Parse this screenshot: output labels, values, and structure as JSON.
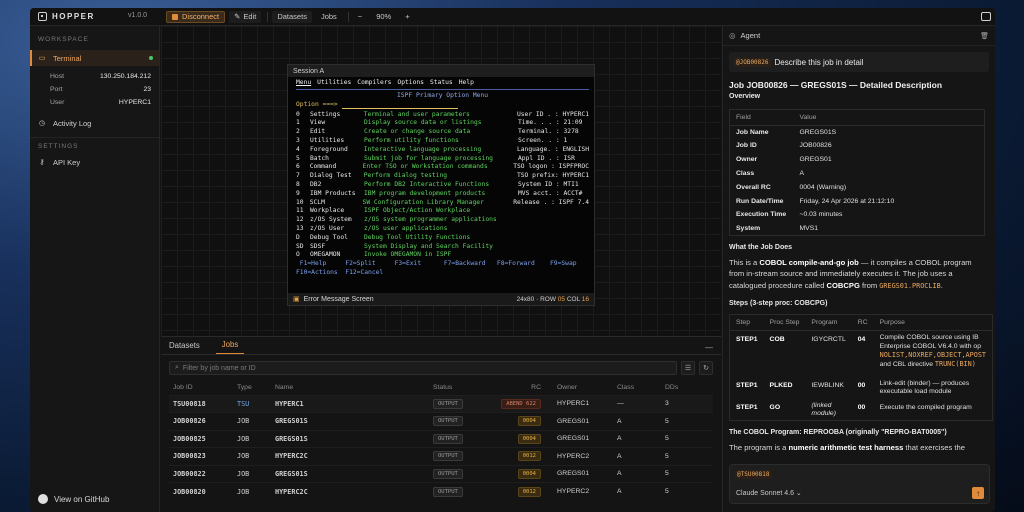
{
  "app": {
    "name": "HOPPER",
    "version": "v1.0.0"
  },
  "toolbar": {
    "disconnect_label": "Disconnect",
    "edit_label": "Edit",
    "datasets_label": "Datasets",
    "jobs_label": "Jobs",
    "zoom_out": "−",
    "zoom": "90%",
    "zoom_in": "+"
  },
  "sidebar": {
    "workspace_header": "WORKSPACE",
    "terminal_label": "Terminal",
    "details": [
      {
        "k": "Host",
        "v": "130.250.184.212"
      },
      {
        "k": "Port",
        "v": "23"
      },
      {
        "k": "User",
        "v": "HYPERC1"
      }
    ],
    "activity_label": "Activity Log",
    "settings_header": "SETTINGS",
    "api_key_label": "API Key",
    "github_label": "View on GitHub"
  },
  "session": {
    "title": "Session A",
    "menu": [
      "Menu",
      "Utilities",
      "Compilers",
      "Options",
      "Status",
      "Help"
    ],
    "panel_title": "ISPF Primary Option Menu",
    "prompt": "Option ===>",
    "options": [
      {
        "num": "0",
        "name": "Settings",
        "desc": "Terminal and user parameters",
        "info": "User ID . : HYPERC1"
      },
      {
        "num": "1",
        "name": "View",
        "desc": "Display source data or listings",
        "info": "Time. . . : 21:09"
      },
      {
        "num": "2",
        "name": "Edit",
        "desc": "Create or change source data",
        "info": "Terminal. : 3278"
      },
      {
        "num": "3",
        "name": "Utilities",
        "desc": "Perform utility functions",
        "info": "Screen. . : 1"
      },
      {
        "num": "4",
        "name": "Foreground",
        "desc": "Interactive language processing",
        "info": "Language. : ENGLISH"
      },
      {
        "num": "5",
        "name": "Batch",
        "desc": "Submit job for language processing",
        "info": "Appl ID . : ISR"
      },
      {
        "num": "6",
        "name": "Command",
        "desc": "Enter TSO or Workstation commands",
        "info": "TSO logon : ISPFPROC"
      },
      {
        "num": "7",
        "name": "Dialog Test",
        "desc": "Perform dialog testing",
        "info": "TSO prefix: HYPERC1"
      },
      {
        "num": "8",
        "name": "DB2",
        "desc": "Perform DB2 Interactive Functions",
        "info": "System ID : MTI1"
      },
      {
        "num": "9",
        "name": "IBM Products",
        "desc": "IBM program development products",
        "info": "MVS acct. : ACCT#"
      },
      {
        "num": "10",
        "name": "SCLM",
        "desc": "SW Configuration Library Manager",
        "info": "Release . : ISPF 7.4"
      },
      {
        "num": "11",
        "name": "Workplace",
        "desc": "ISPF Object/Action Workplace",
        "info": ""
      },
      {
        "num": "12",
        "name": "z/OS System",
        "desc": "z/OS system programmer applications",
        "info": ""
      },
      {
        "num": "13",
        "name": "z/OS User",
        "desc": "z/OS user applications",
        "info": ""
      },
      {
        "num": "D",
        "name": "Debug Tool",
        "desc": "Debug Tool Utility Functions",
        "info": ""
      },
      {
        "num": "SD",
        "name": "SDSF",
        "desc": "System Display and Search Facility",
        "info": ""
      },
      {
        "num": "O",
        "name": "OMEGAMON",
        "desc": "Invoke OMEGAMON in ISPF",
        "info": ""
      }
    ],
    "fkeys_1": " F1=Help     F2=Split     F3=Exit      F7=Backward   F8=Forward    F9=Swap",
    "fkeys_2": "F10=Actions  F12=Cancel",
    "status_msg": "Error Message Screen",
    "geom": "24x80",
    "row_label": "ROW",
    "row": "05",
    "col_label": "COL",
    "col": "16"
  },
  "jobs_panel": {
    "tabs": [
      "Datasets",
      "Jobs"
    ],
    "filter_placeholder": "Filter by job name or ID",
    "columns": [
      "Job ID",
      "Type",
      "Name",
      "Status",
      "RC",
      "Owner",
      "Class",
      "DDs"
    ],
    "rows": [
      {
        "id": "TSU00818",
        "type": "TSU",
        "name": "HYPERC1",
        "status": "OUTPUT",
        "rc": "ABEND 622",
        "owner": "HYPERC1",
        "class": "—",
        "dds": "3"
      },
      {
        "id": "JOB00826",
        "type": "JOB",
        "name": "GREGS01S",
        "status": "OUTPUT",
        "rc": "0004",
        "owner": "GREGS01",
        "class": "A",
        "dds": "5"
      },
      {
        "id": "JOB00825",
        "type": "JOB",
        "name": "GREGS01S",
        "status": "OUTPUT",
        "rc": "0004",
        "owner": "GREGS01",
        "class": "A",
        "dds": "5"
      },
      {
        "id": "JOB00823",
        "type": "JOB",
        "name": "HYPERC2C",
        "status": "OUTPUT",
        "rc": "0012",
        "owner": "HYPERC2",
        "class": "A",
        "dds": "5"
      },
      {
        "id": "JOB00822",
        "type": "JOB",
        "name": "GREGS01S",
        "status": "OUTPUT",
        "rc": "0004",
        "owner": "GREGS01",
        "class": "A",
        "dds": "5"
      },
      {
        "id": "JOB00820",
        "type": "JOB",
        "name": "HYPERC2C",
        "status": "OUTPUT",
        "rc": "0012",
        "owner": "HYPERC2",
        "class": "A",
        "dds": "5"
      }
    ]
  },
  "agent": {
    "title": "Agent",
    "user_chip": "@JOB00826",
    "user_msg": "Describe this job in detail",
    "heading": "Job JOB00826 — GREGS01S — Detailed Description",
    "overview": "Overview",
    "table_headers": [
      "Field",
      "Value"
    ],
    "fields": [
      {
        "f": "Job Name",
        "v": "GREGS01S"
      },
      {
        "f": "Job ID",
        "v": "JOB00826"
      },
      {
        "f": "Owner",
        "v": "GREGS01"
      },
      {
        "f": "Class",
        "v": "A"
      },
      {
        "f": "Overall RC",
        "v": "0004 (Warning)"
      },
      {
        "f": "Run Date/Time",
        "v": "Friday, 24 Apr 2026 at 21:12:10"
      },
      {
        "f": "Execution Time",
        "v": "~0.03 minutes"
      },
      {
        "f": "System",
        "v": "MVS1"
      }
    ],
    "what_heading": "What the Job Does",
    "what_l1_a": "This is a ",
    "what_l1_b": "COBOL compile-and-go job",
    "what_l1_c": " — it compiles a COBOL program",
    "what_l2": "from in-stream source and immediately executes it. The job uses a",
    "what_l3_a": "catalogued procedure called ",
    "what_l3_b": "COBCPG",
    "what_l3_c": " from ",
    "what_l3_d": "GREGS01.PROCLIB",
    "what_l3_e": ".",
    "steps_heading": "Steps (3-step proc: COBCPG)",
    "step_headers": [
      "Step",
      "Proc Step",
      "Program",
      "RC",
      "Purpose"
    ],
    "steps": [
      {
        "step": "STEP1",
        "proc": "COB",
        "prog": "IGYCRCTL",
        "rc": "04",
        "p1": "Compile COBOL source using IB",
        "p2": "Enterprise COBOL V6.4.0 with op",
        "p3": "NOLIST,NOXREF,OBJECT,APOST",
        "p4a": "and CBL directive ",
        "p4b": "TRUNC(BIN)"
      },
      {
        "step": "STEP1",
        "proc": "PLKED",
        "prog": "IEWBLINK",
        "rc": "00",
        "p1": "Link-edit (binder) — produces",
        "p2": "executable load module"
      },
      {
        "step": "STEP1",
        "proc": "GO",
        "prog_1": "(linked",
        "prog_2": "module)",
        "rc": "00",
        "p1": "Execute the compiled program"
      }
    ],
    "program_heading": "The COBOL Program: REPROOBA (originally \"REPRO-BAT0005\")",
    "program_l1_a": "The program is a ",
    "program_l1_b": "numeric arithmetic test harness",
    "program_l1_c": " that exercises the",
    "composer_chip": "@TSU00818",
    "model": "Claude Sonnet 4.6 ⌄",
    "send_icon": "↑"
  }
}
